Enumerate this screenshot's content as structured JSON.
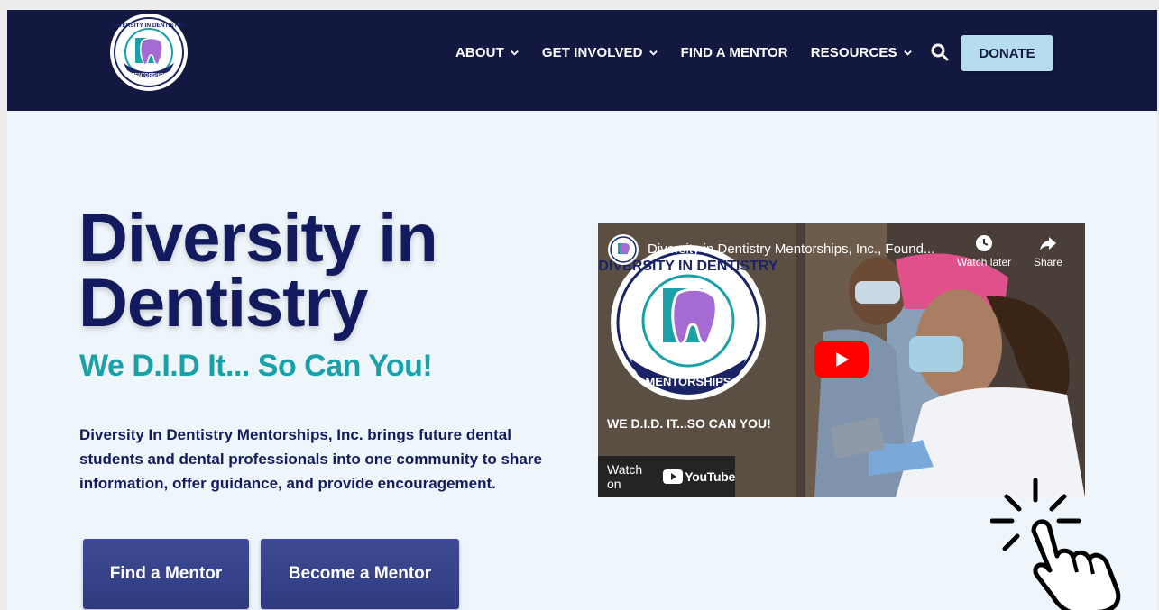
{
  "logo": {
    "ring_top": "DIVERSITY IN DENTISTRY",
    "ring_bottom": "MENTORSHIPS"
  },
  "nav": {
    "items": [
      {
        "label": "ABOUT",
        "has_dropdown": true
      },
      {
        "label": "GET INVOLVED",
        "has_dropdown": true
      },
      {
        "label": "FIND A MENTOR",
        "has_dropdown": false
      },
      {
        "label": "RESOURCES",
        "has_dropdown": true
      }
    ],
    "donate_label": "DONATE"
  },
  "hero": {
    "title_line1": "Diversity in",
    "title_line2": "Dentistry",
    "tagline": "We D.I.D It... So Can You!",
    "description": "Diversity In Dentistry Mentorships, Inc. brings future dental students and dental professionals into one community to share information, offer guidance, and provide encouragement.",
    "find_mentor_label": "Find a Mentor",
    "become_mentor_label": "Become a Mentor"
  },
  "video": {
    "title": "Diversity in Dentistry Mentorships, Inc., Found...",
    "watch_later_label": "Watch later",
    "share_label": "Share",
    "overlay_text": "WE D.I.D. IT...SO CAN YOU!",
    "watch_on_label": "Watch on",
    "platform_label": "YouTube"
  },
  "colors": {
    "navy": "#131840",
    "heading": "#131a5e",
    "teal": "#1aa1a8",
    "donate_bg": "#b6dcf0",
    "button_bg": "#3e4b93",
    "youtube_red": "#ff0000"
  },
  "icons": {
    "search": "search-icon",
    "dropdown": "chevron-down-icon",
    "play": "play-icon",
    "clock": "clock-icon",
    "share": "share-arrow-icon",
    "cursor": "pointing-hand-click-icon"
  }
}
